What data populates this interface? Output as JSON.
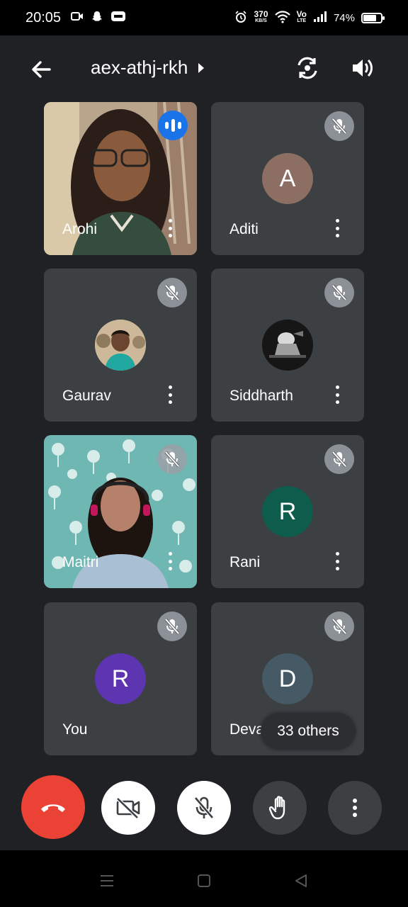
{
  "status_bar": {
    "time": "20:05",
    "speed_value": "370",
    "speed_unit": "KB/S",
    "network_label_top": "Vo",
    "network_label_bottom": "LTE",
    "battery_percent": "74%",
    "battery_level": 0.74
  },
  "header": {
    "meeting_code": "aex-athj-rkh"
  },
  "participants": [
    {
      "name": "Arohi",
      "state": "speaking",
      "kind": "video"
    },
    {
      "name": "Aditi",
      "state": "muted",
      "kind": "avatar",
      "initial": "A",
      "avatar_color": "#8d6e63"
    },
    {
      "name": "Gaurav",
      "state": "muted",
      "kind": "photo"
    },
    {
      "name": "Siddharth",
      "state": "muted",
      "kind": "photo"
    },
    {
      "name": "Maitri",
      "state": "muted",
      "kind": "video"
    },
    {
      "name": "Rani",
      "state": "muted",
      "kind": "avatar",
      "initial": "R",
      "avatar_color": "#0d5c4c"
    },
    {
      "name": "You",
      "state": "muted",
      "kind": "avatar",
      "initial": "R",
      "avatar_color": "#5e35b1"
    },
    {
      "name": "Devanshi",
      "state": "muted",
      "kind": "avatar",
      "initial": "D",
      "avatar_color": "#455a64"
    }
  ],
  "others_pill": "33 others",
  "colors": {
    "background": "#202124",
    "tile": "#3c4043",
    "end_call": "#ea4335",
    "speaking": "#1a73e8"
  },
  "controls": [
    {
      "name": "end-call",
      "icon": "phone-hangup-icon"
    },
    {
      "name": "camera-off",
      "icon": "video-off-icon"
    },
    {
      "name": "mic-off",
      "icon": "mic-off-icon"
    },
    {
      "name": "raise-hand",
      "icon": "hand-icon"
    },
    {
      "name": "more-options",
      "icon": "more-vert-icon"
    }
  ]
}
